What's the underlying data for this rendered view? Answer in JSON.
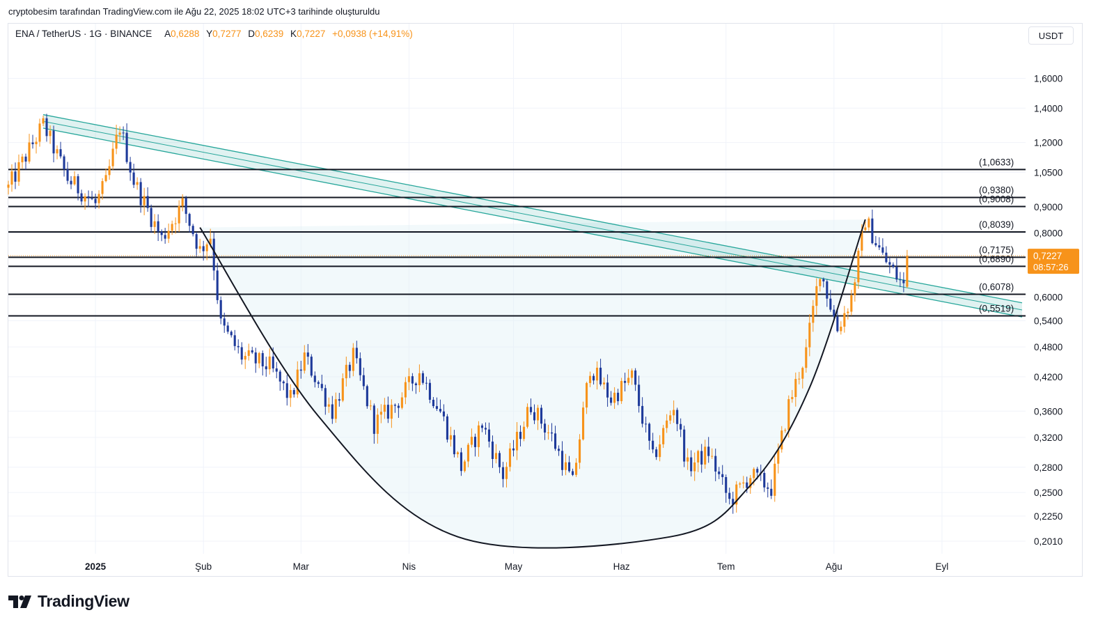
{
  "attribution": "cryptobesim tarafından TradingView.com ile Ağu 22, 2025 18:02 UTC+3 tarihinde oluşturuldu",
  "legend": {
    "symbol": "ENA / TetherUS · 1G · BINANCE",
    "open_label": "A",
    "open": "0,6288",
    "high_label": "Y",
    "high": "0,7277",
    "low_label": "D",
    "low": "0,6239",
    "close_label": "K",
    "close": "0,7227",
    "change": "+0,0938 (+14,91%)"
  },
  "currency": "USDT",
  "brand": "TradingView",
  "colors": {
    "up": "#f7931a",
    "down": "#1e3a9a",
    "channel": "#26a69a",
    "badge": "#f7931a"
  },
  "chart_data": {
    "type": "candlestick",
    "y_scale": "log",
    "ylim": [
      0.19,
      1.85
    ],
    "y_ticks": [
      "1,6000",
      "1,4000",
      "1,2000",
      "1,0500",
      "0,9000",
      "0,8000",
      "0,6000",
      "0,5400",
      "0,4800",
      "0,4200",
      "0,3600",
      "0,3200",
      "0,2800",
      "0,2500",
      "0,2250",
      "0,2010"
    ],
    "x_ticks": [
      "2025",
      "Şub",
      "Mar",
      "Nis",
      "May",
      "Haz",
      "Tem",
      "Ağu",
      "Eyl"
    ],
    "x_tick_dates": [
      "2025-01-01",
      "2025-02-01",
      "2025-03-01",
      "2025-04-01",
      "2025-05-01",
      "2025-06-01",
      "2025-07-01",
      "2025-08-01",
      "2025-09-01"
    ],
    "xlim_dates": [
      "2024-12-07",
      "2025-09-25"
    ],
    "horizontal_levels": [
      {
        "value": 1.0633,
        "label": "(1,0633)"
      },
      {
        "value": 0.938,
        "label": "(0,9380)"
      },
      {
        "value": 0.9008,
        "label": "(0,9008)"
      },
      {
        "value": 0.8039,
        "label": "(0,8039)"
      },
      {
        "value": 0.7175,
        "label": "(0,7175)"
      },
      {
        "value": 0.689,
        "label": "(0,6890)"
      },
      {
        "value": 0.6078,
        "label": "(0,6078)"
      },
      {
        "value": 0.5519,
        "label": "(0,5519)"
      }
    ],
    "last_price": {
      "value": 0.7227,
      "label": "0,7227",
      "countdown": "08:57:26"
    },
    "descending_channel": {
      "start": {
        "date": "2024-12-17",
        "upper": 1.36,
        "lower": 1.28
      },
      "end": {
        "date": "2025-09-24",
        "upper": 0.585,
        "lower": 0.549
      }
    },
    "cup_curve_points": [
      {
        "date": "2025-01-31",
        "value": 0.82
      },
      {
        "date": "2025-03-06",
        "value": 0.352
      },
      {
        "date": "2025-04-15",
        "value": 0.205
      },
      {
        "date": "2025-06-15",
        "value": 0.205
      },
      {
        "date": "2025-07-08",
        "value": 0.258
      },
      {
        "date": "2025-07-25",
        "value": 0.4
      },
      {
        "date": "2025-08-10",
        "value": 0.85
      }
    ],
    "anchors": [
      [
        "2024-12-07",
        0.98
      ],
      [
        "2024-12-17",
        1.3
      ],
      [
        "2024-12-24",
        1.02
      ],
      [
        "2025-01-01",
        0.91
      ],
      [
        "2025-01-04",
        1.0
      ],
      [
        "2025-01-08",
        1.29
      ],
      [
        "2025-01-12",
        1.01
      ],
      [
        "2025-01-20",
        0.78
      ],
      [
        "2025-01-26",
        0.91
      ],
      [
        "2025-01-31",
        0.74
      ],
      [
        "2025-02-03",
        0.79
      ],
      [
        "2025-02-06",
        0.53
      ],
      [
        "2025-02-12",
        0.46
      ],
      [
        "2025-02-20",
        0.44
      ],
      [
        "2025-02-26",
        0.38
      ],
      [
        "2025-03-02",
        0.46
      ],
      [
        "2025-03-10",
        0.36
      ],
      [
        "2025-03-16",
        0.46
      ],
      [
        "2025-03-22",
        0.34
      ],
      [
        "2025-03-28",
        0.37
      ],
      [
        "2025-04-04",
        0.43
      ],
      [
        "2025-04-10",
        0.36
      ],
      [
        "2025-04-16",
        0.28
      ],
      [
        "2025-04-22",
        0.34
      ],
      [
        "2025-04-28",
        0.27
      ],
      [
        "2025-05-06",
        0.37
      ],
      [
        "2025-05-12",
        0.32
      ],
      [
        "2025-05-18",
        0.26
      ],
      [
        "2025-05-23",
        0.44
      ],
      [
        "2025-05-29",
        0.38
      ],
      [
        "2025-06-04",
        0.42
      ],
      [
        "2025-06-10",
        0.29
      ],
      [
        "2025-06-16",
        0.37
      ],
      [
        "2025-06-20",
        0.28
      ],
      [
        "2025-06-26",
        0.3
      ],
      [
        "2025-07-02",
        0.24
      ],
      [
        "2025-07-08",
        0.27
      ],
      [
        "2025-07-14",
        0.255
      ],
      [
        "2025-07-19",
        0.37
      ],
      [
        "2025-07-24",
        0.47
      ],
      [
        "2025-07-28",
        0.68
      ],
      [
        "2025-08-02",
        0.52
      ],
      [
        "2025-08-06",
        0.6
      ],
      [
        "2025-08-10",
        0.85
      ],
      [
        "2025-08-15",
        0.72
      ],
      [
        "2025-08-21",
        0.63
      ],
      [
        "2025-08-22",
        0.7227
      ]
    ]
  }
}
